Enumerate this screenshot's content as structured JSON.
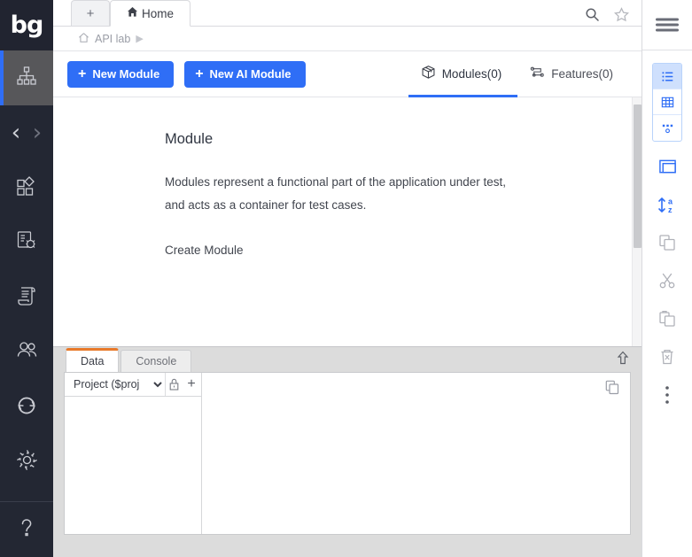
{
  "app": {
    "logo": "bg",
    "accent_blue": "#2f6ef6",
    "tab_active_orange": "#e8792a"
  },
  "left_rail": {
    "items": [
      {
        "name": "modules-hierarchy",
        "icon": "sitemap-icon",
        "active": true
      },
      {
        "name": "elements",
        "icon": "shapes-icon",
        "active": false
      },
      {
        "name": "debug-report",
        "icon": "bug-report-icon",
        "active": false
      },
      {
        "name": "scripts",
        "icon": "scroll-icon",
        "active": false
      },
      {
        "name": "users",
        "icon": "users-icon",
        "active": false
      },
      {
        "name": "sync",
        "icon": "refresh-circle-icon",
        "active": false
      },
      {
        "name": "settings",
        "icon": "gear-icon",
        "active": false
      },
      {
        "name": "help",
        "icon": "question-mark-icon",
        "active": false
      }
    ],
    "nav": {
      "back": "‹",
      "forward": "›"
    }
  },
  "tabstrip": {
    "new_tab_label": "+",
    "tabs": [
      {
        "label": "Home",
        "icon": "home-icon",
        "active": true
      }
    ],
    "search_icon": "search-icon",
    "favorite_icon": "star-icon"
  },
  "breadcrumb": {
    "home_icon": "home-outline-icon",
    "items": [
      "API lab"
    ],
    "arrow": "▶"
  },
  "toolbar": {
    "new_module_label": "New Module",
    "new_ai_module_label": "New AI Module",
    "plus": "+",
    "tabs": [
      {
        "label": "Modules(0)",
        "icon": "box-icon",
        "active": true
      },
      {
        "label": "Features(0)",
        "icon": "flow-icon",
        "active": false
      }
    ]
  },
  "main": {
    "title": "Module",
    "description_line1": "Modules represent a functional part of the application under test,",
    "description_line2": "and acts as a container for test cases.",
    "create_link": "Create Module"
  },
  "bottom_panel": {
    "tabs": [
      {
        "label": "Data",
        "active": true
      },
      {
        "label": "Console",
        "active": false
      }
    ],
    "collapse_icon": "arrow-up-icon",
    "variable_scope_value": "Project ($proj",
    "variable_scope_options": [
      "Project ($proj"
    ],
    "lock_icon": "lock-icon",
    "add_icon": "+",
    "copy_icon": "copy-icon"
  },
  "right_rail": {
    "menu_icon": "hamburger-menu-icon",
    "view_group": [
      {
        "name": "list-view",
        "icon": "list-icon",
        "active": true
      },
      {
        "name": "grid-view",
        "icon": "table-grid-icon",
        "active": false
      },
      {
        "name": "graph-view",
        "icon": "node-graph-icon",
        "active": false
      }
    ],
    "tools": [
      {
        "name": "panel-view",
        "icon": "window-icon",
        "enabled": true
      },
      {
        "name": "sort-az",
        "icon": "sort-alpha-icon",
        "enabled": true
      },
      {
        "name": "duplicate",
        "icon": "copy-icon",
        "enabled": false
      },
      {
        "name": "cut",
        "icon": "scissors-icon",
        "enabled": false
      },
      {
        "name": "paste",
        "icon": "paste-icon",
        "enabled": false
      },
      {
        "name": "delete",
        "icon": "trash-icon",
        "enabled": false
      },
      {
        "name": "more-options",
        "icon": "vertical-dots-icon",
        "enabled": true
      }
    ]
  }
}
